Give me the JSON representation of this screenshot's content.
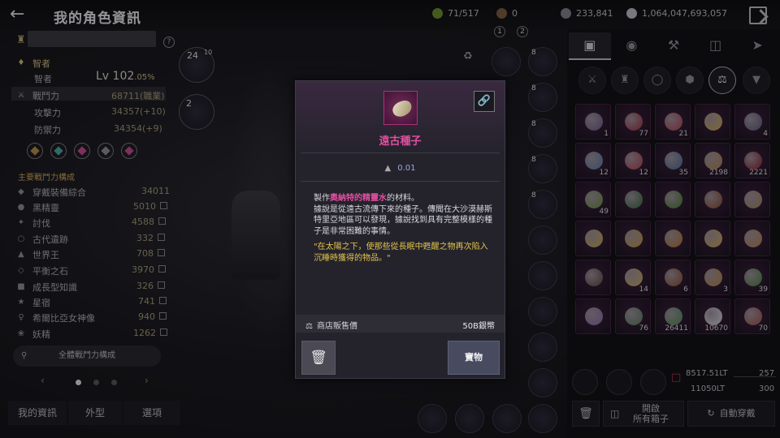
{
  "header": {
    "title": "我的角色資訊",
    "back_icon": "back-arrow-icon"
  },
  "currencies": [
    {
      "value": "71/517",
      "color": "#7c9a3a"
    },
    {
      "value": "0",
      "color": "#8a6c4a"
    },
    {
      "value": "233,841",
      "color": "#8e8e9a"
    },
    {
      "value": "1,064,047,693,057",
      "color": "#c0c0c8"
    }
  ],
  "character": {
    "class": "智者",
    "stats": [
      {
        "label": "智者",
        "value": ""
      },
      {
        "label": "戰鬥力",
        "value": "68711(職業)"
      },
      {
        "label": "攻擊力",
        "value": "34357(+10)"
      },
      {
        "label": "防禦力",
        "value": "34354(+9)"
      }
    ],
    "level_prefix": "Lv 102",
    "level_pct": ".05%",
    "power_section_title": "主要戰鬥力構成",
    "power_rows": [
      {
        "label": "穿戴裝備綜合",
        "value": "34011"
      },
      {
        "label": "黑精靈",
        "value": "5010"
      },
      {
        "label": "討伐",
        "value": "4588"
      },
      {
        "label": "古代遺跡",
        "value": "332"
      },
      {
        "label": "世界王",
        "value": "708"
      },
      {
        "label": "平衡之石",
        "value": "3970"
      },
      {
        "label": "成長型知識",
        "value": "326"
      },
      {
        "label": "星宿",
        "value": "741"
      },
      {
        "label": "希爾比亞女神像",
        "value": "940"
      },
      {
        "label": "妖精",
        "value": "1262"
      }
    ],
    "full_power_button": "全體戰鬥力構成",
    "pager": {
      "prev": "‹",
      "next": "›"
    },
    "bottom_tabs": [
      "我的資訊",
      "外型",
      "選項"
    ]
  },
  "middle": {
    "badge_24": "24",
    "badge_10": "10",
    "badge_2": "2",
    "page_tabs": [
      "1",
      "2"
    ],
    "slot_8": "8"
  },
  "modal": {
    "item_name": "遠古種子",
    "weight": "0.01",
    "desc_pre": "製作",
    "desc_highlight": "奧納特的精靈水",
    "desc_post": "的材料。\n據說是從遠古流傳下來的種子。傳聞在大沙漠赫斯特里亞地區可以發現，據說找到具有完整模樣的種子是非常困難的事情。",
    "lore": "\"在太陽之下，使那些從長眠中甦醒之物再次陷入沉睡時獲得的物品。\"",
    "price_label": "商店販售價",
    "price_value": "50B銀幣",
    "treasure_button": "寶物",
    "trash_icon": "trash-icon",
    "link_icon": "link-icon"
  },
  "inventory": {
    "quantities": [
      "1",
      "77",
      "21",
      "",
      "4",
      "12",
      "12",
      "35",
      "2198",
      "2221",
      "49",
      "",
      "",
      "",
      "",
      "",
      "",
      "",
      "",
      "",
      "",
      "14",
      "6",
      "3",
      "39",
      "",
      "76",
      "26411",
      "10670",
      "70"
    ],
    "weight_value": "8517.51LT",
    "weight_max": "11050LT",
    "slots_value": "257",
    "slots_max": "300",
    "open_all_button": "開啟\n所有箱子",
    "auto_equip_button": "自動穿戴"
  }
}
